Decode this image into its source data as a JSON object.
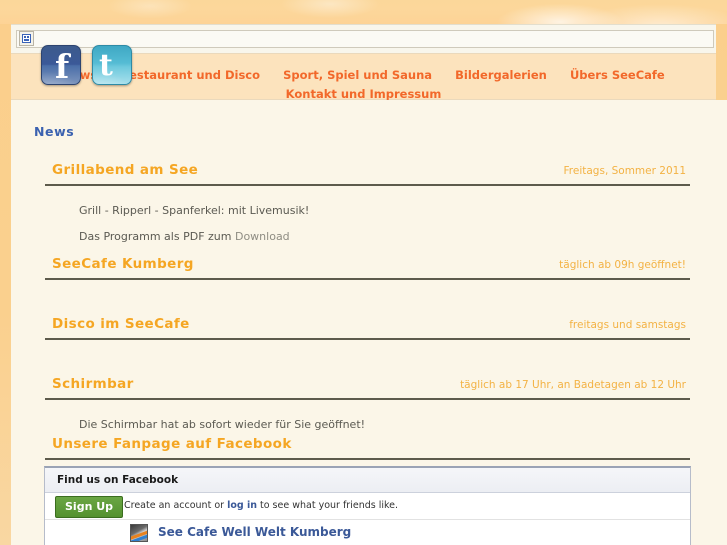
{
  "header": {
    "search_placeholder": "",
    "search_value": "",
    "broken_image_alt": "broken-image"
  },
  "nav": {
    "items": [
      {
        "label": "News"
      },
      {
        "label": "Restaurant und Disco"
      },
      {
        "label": "Sport, Spiel und Sauna"
      },
      {
        "label": "Bildergalerien"
      },
      {
        "label": "Übers SeeCafe"
      },
      {
        "label": "Kontakt und Impressum"
      }
    ]
  },
  "social": {
    "facebook_label": "f",
    "twitter_label": "t"
  },
  "main": {
    "page_title": "News",
    "news": [
      {
        "title": "Grillabend am See",
        "date": "Freitags, Sommer 2011",
        "lines": [
          "Grill - Ripperl - Spanferkel: mit Livemusik!",
          "Das Programm als PDF zum "
        ],
        "link_label": "Download"
      },
      {
        "title": "SeeCafe Kumberg",
        "date": "täglich ab 09h geöffnet!",
        "lines": [],
        "link_label": ""
      },
      {
        "title": "Disco im SeeCafe",
        "date": "freitags und samstags",
        "lines": [],
        "link_label": ""
      },
      {
        "title": "Schirmbar",
        "date": "täglich ab 17 Uhr, an Badetagen ab 12 Uhr",
        "lines": [
          "Die Schirmbar hat ab sofort wieder für Sie geöffnet!"
        ],
        "link_label": ""
      },
      {
        "title": "Unsere Fanpage auf Facebook",
        "date": "",
        "lines": [],
        "link_label": ""
      }
    ]
  },
  "facebook_widget": {
    "header": "Find us on Facebook",
    "signup_button": "Sign Up",
    "signup_text_before": "Create an account or ",
    "signup_link": "log in",
    "signup_text_after": " to see what your friends like.",
    "page_name": "See Cafe Well Welt Kumberg"
  },
  "colors": {
    "banner": "#fcd79b",
    "nav_band": "#fce3bd",
    "nav_link": "#f2682a",
    "content_bg": "#fbf6e8",
    "heading_blue": "#3b62b0",
    "news_title": "#f5a623",
    "news_date": "#f3b244",
    "rule": "#5d5b4c",
    "fb_blue": "#3b5998",
    "signup_green": "#54912f"
  }
}
